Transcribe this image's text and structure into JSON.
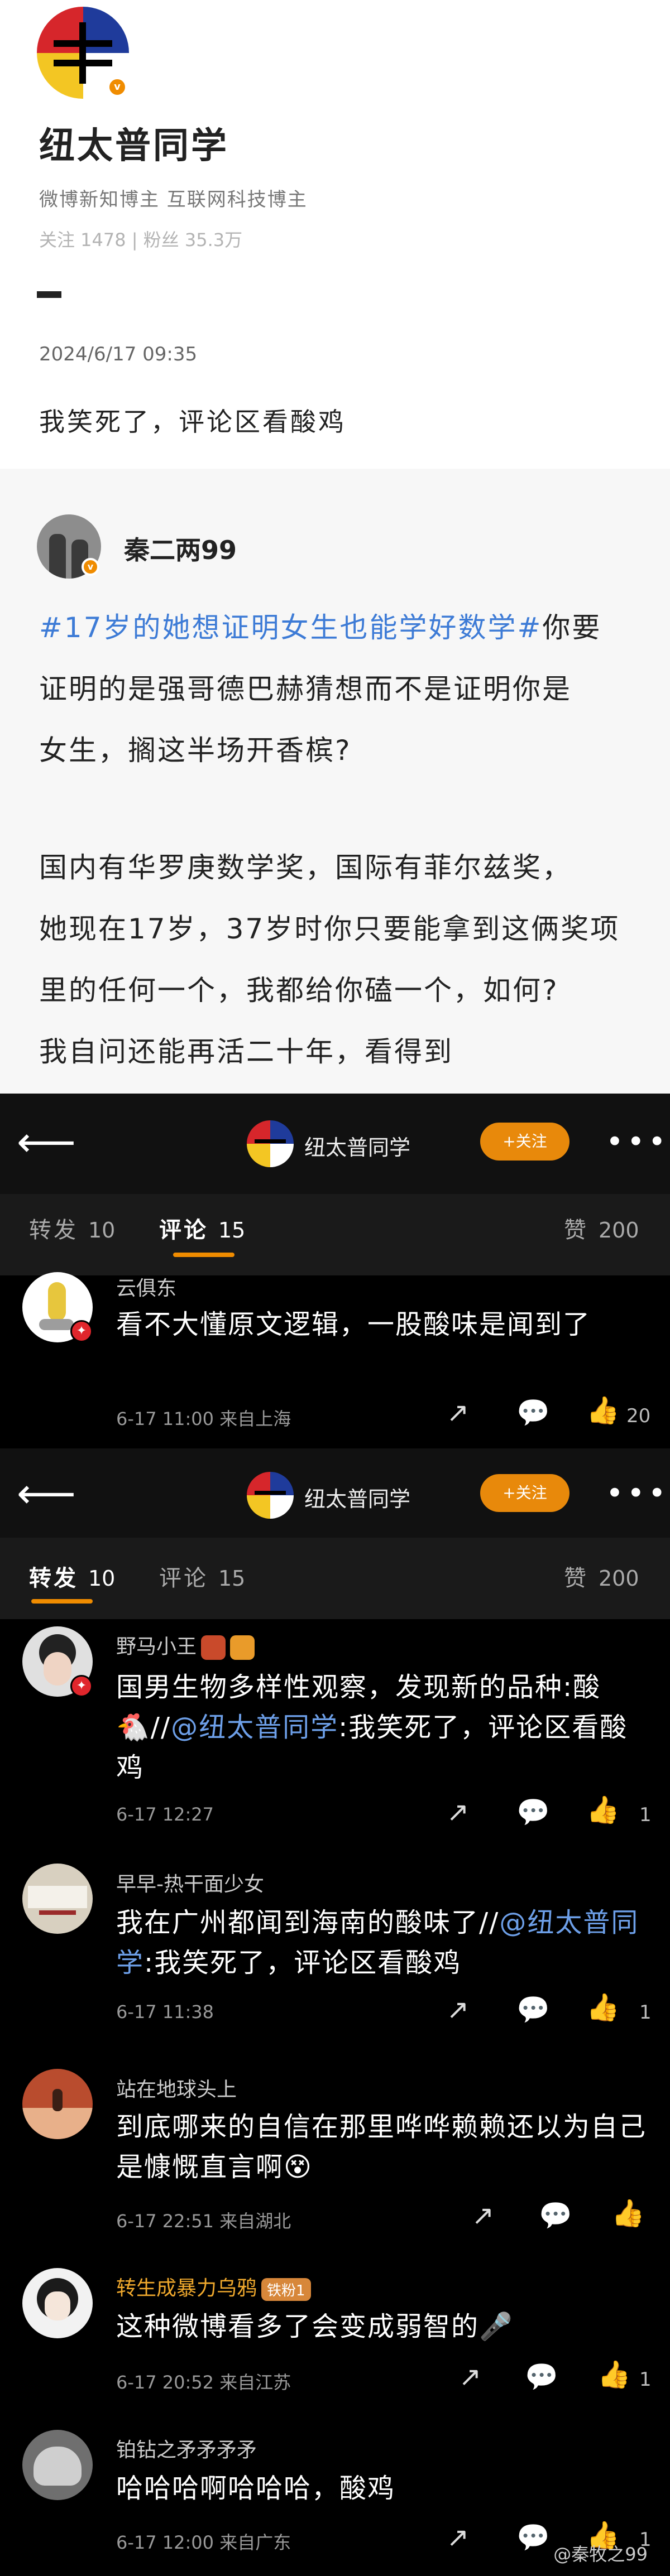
{
  "profile": {
    "name": "纽太普同学",
    "tags": "微博新知博主  互联网科技博主",
    "stats": "关注 1478 | 粉丝 35.3万",
    "post_time": "2024/6/17  09:35",
    "post_text": "我笑死了，评论区看酸鸡",
    "verified_mark": "v"
  },
  "quoted": {
    "author": "秦二两99",
    "hashtag": "#17岁的她想证明女生也能学好数学#",
    "lines": [
      "你要",
      "证明的是强哥德巴赫猜想而不是证明你是",
      "女生，搁这半场开香槟?",
      "国内有华罗庚数学奖，国际有菲尔兹奖，",
      "她现在17岁，37岁时你只要能拿到这俩奖项",
      "里的任何一个，我都给你磕一个，如何?",
      "我自问还能再活二十年，看得到"
    ]
  },
  "header": {
    "back": "⟵",
    "name": "纽太普同学",
    "follow": "+关注",
    "more": "•••"
  },
  "tabs_a": {
    "repost_label": "转发",
    "repost_count": "10",
    "comment_label": "评论",
    "comment_count": "15",
    "like_label": "赞",
    "like_count": "200"
  },
  "tabs_b": {
    "repost_label": "转发",
    "repost_count": "10",
    "comment_label": "评论",
    "comment_count": "15",
    "like_label": "赞",
    "like_count": "200"
  },
  "comment_top": {
    "name": "云俱东",
    "text": "看不大懂原文逻辑，一股酸味是闻到了",
    "meta": "6-17  11:00  来自上海",
    "likes": "20"
  },
  "reposts": [
    {
      "name": "野马小王",
      "text_before": "国男生物多样性观察，发现新的品种:酸",
      "text_emoji": "🐔",
      "text_sep": "//",
      "mention": "@纽太普同学",
      "text_after": ":我笑死了，评论区看酸鸡",
      "meta": "6-17  12:27",
      "likes": "1"
    },
    {
      "name": "早早-热干面少女",
      "text_before": "我在广州都闻到海南的酸味了//",
      "mention": "@纽太普同学",
      "text_after": ":我笑死了，评论区看酸鸡",
      "meta": "6-17  11:38",
      "likes": "1"
    },
    {
      "name": "站在地球头上",
      "text": "到底哪来的自信在那里哗哗赖赖还以为自己是慷慨直言啊",
      "text_emoji": "😵",
      "meta": "6-17  22:51  来自湖北",
      "likes": ""
    },
    {
      "name": "转生成暴力乌鸦",
      "fan_badge": "铁粉1",
      "text": "这种微博看多了会变成弱智的",
      "text_emoji": "🎤",
      "meta": "6-17  20:52  来自江苏",
      "likes": "1"
    },
    {
      "name": "铂钻之矛矛矛矛",
      "text": "哈哈哈啊哈哈哈，酸鸡",
      "meta": "6-17  12:00  来自广东",
      "likes": "1"
    }
  ],
  "icons": {
    "share": "↗",
    "comment": "💬",
    "like": "👍"
  },
  "watermark": "@秦牧之99"
}
